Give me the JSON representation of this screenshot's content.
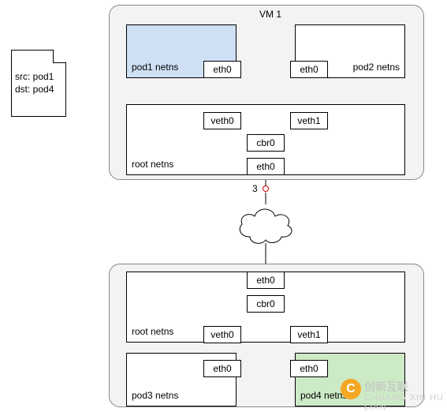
{
  "packet": {
    "src_line": "src: pod1",
    "dst_line": "dst: pod4"
  },
  "vm1": {
    "title": "VM 1",
    "pod1": {
      "label": "pod1 netns",
      "eth": "eth0"
    },
    "pod2": {
      "label": "pod2 netns",
      "eth": "eth0"
    },
    "root": {
      "label": "root netns",
      "veth0": "veth0",
      "veth1": "veth1",
      "cbr0": "cbr0",
      "eth0": "eth0"
    }
  },
  "marker": {
    "num": "3"
  },
  "vm2": {
    "root": {
      "label": "root netns",
      "eth0": "eth0",
      "cbr0": "cbr0",
      "veth0": "veth0",
      "veth1": "veth1"
    },
    "pod3": {
      "label": "pod3 netns",
      "eth": "eth0"
    },
    "pod4": {
      "label": "pod4 netns",
      "eth": "eth0"
    }
  },
  "branding": {
    "logo_letter": "C",
    "text1": "创新互联",
    "text2": "CHUANG XIN HU LIAN"
  }
}
